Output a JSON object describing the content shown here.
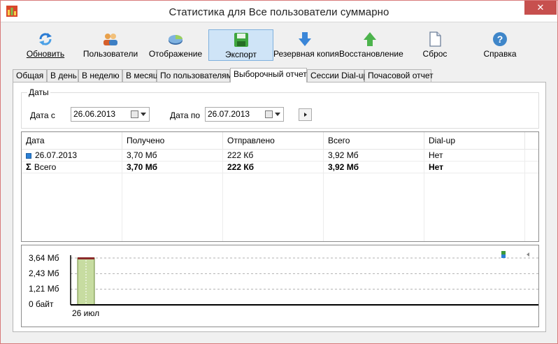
{
  "window": {
    "title": "Статистика для Все пользователи суммарно",
    "close_glyph": "✕"
  },
  "toolbar": [
    {
      "label": "Обновить",
      "icon": "refresh-icon"
    },
    {
      "label": "Пользователи",
      "icon": "users-icon"
    },
    {
      "label": "Отображение",
      "icon": "pie-chart-icon"
    },
    {
      "label": "Экспорт",
      "icon": "floppy-icon",
      "active": true
    },
    {
      "label": "Резервная копия",
      "icon": "arrow-down-icon"
    },
    {
      "label": "Восстановление",
      "icon": "arrow-up-icon"
    },
    {
      "label": "Сброс",
      "icon": "blank-page-icon"
    },
    {
      "label": "Справка",
      "icon": "help-icon"
    }
  ],
  "tabs": [
    "Общая",
    "В день",
    "В неделю",
    "В месяц",
    "По пользователям",
    "Выборочный отчет",
    "Сессии Dial-up",
    "Почасовой отчет"
  ],
  "active_tab": "Выборочный отчет",
  "dates": {
    "legend": "Даты",
    "from_label": "Дата с",
    "from_value": "26.06.2013",
    "to_label": "Дата по",
    "to_value": "26.07.2013"
  },
  "table": {
    "columns": [
      "Дата",
      "Получено",
      "Отправлено",
      "Всего",
      "Dial-up"
    ],
    "rows": [
      [
        "26.07.2013",
        "3,70 Мб",
        "222 Кб",
        "3,92 Мб",
        "Нет"
      ]
    ],
    "total": [
      "Всего",
      "3,70 Мб",
      "222 Кб",
      "3,92 Мб",
      "Нет"
    ]
  },
  "chart_data": {
    "type": "bar",
    "categories": [
      "26 июл"
    ],
    "y_tick_labels": [
      "3,64 Мб",
      "2,43 Мб",
      "1,21 Мб",
      "0 байт"
    ],
    "series": [
      {
        "values": [
          3.92
        ]
      }
    ],
    "ylim": [
      0,
      3.64
    ],
    "grid": true,
    "colors": {
      "bar": "#c7dca1",
      "bar_edge": "#6e8a3a",
      "bar_cap": "#8b2a2a"
    }
  },
  "colors": {
    "close_button": "#c7504e",
    "active_button": "#cfe4f7",
    "row_marker": "#2b7fd4"
  }
}
